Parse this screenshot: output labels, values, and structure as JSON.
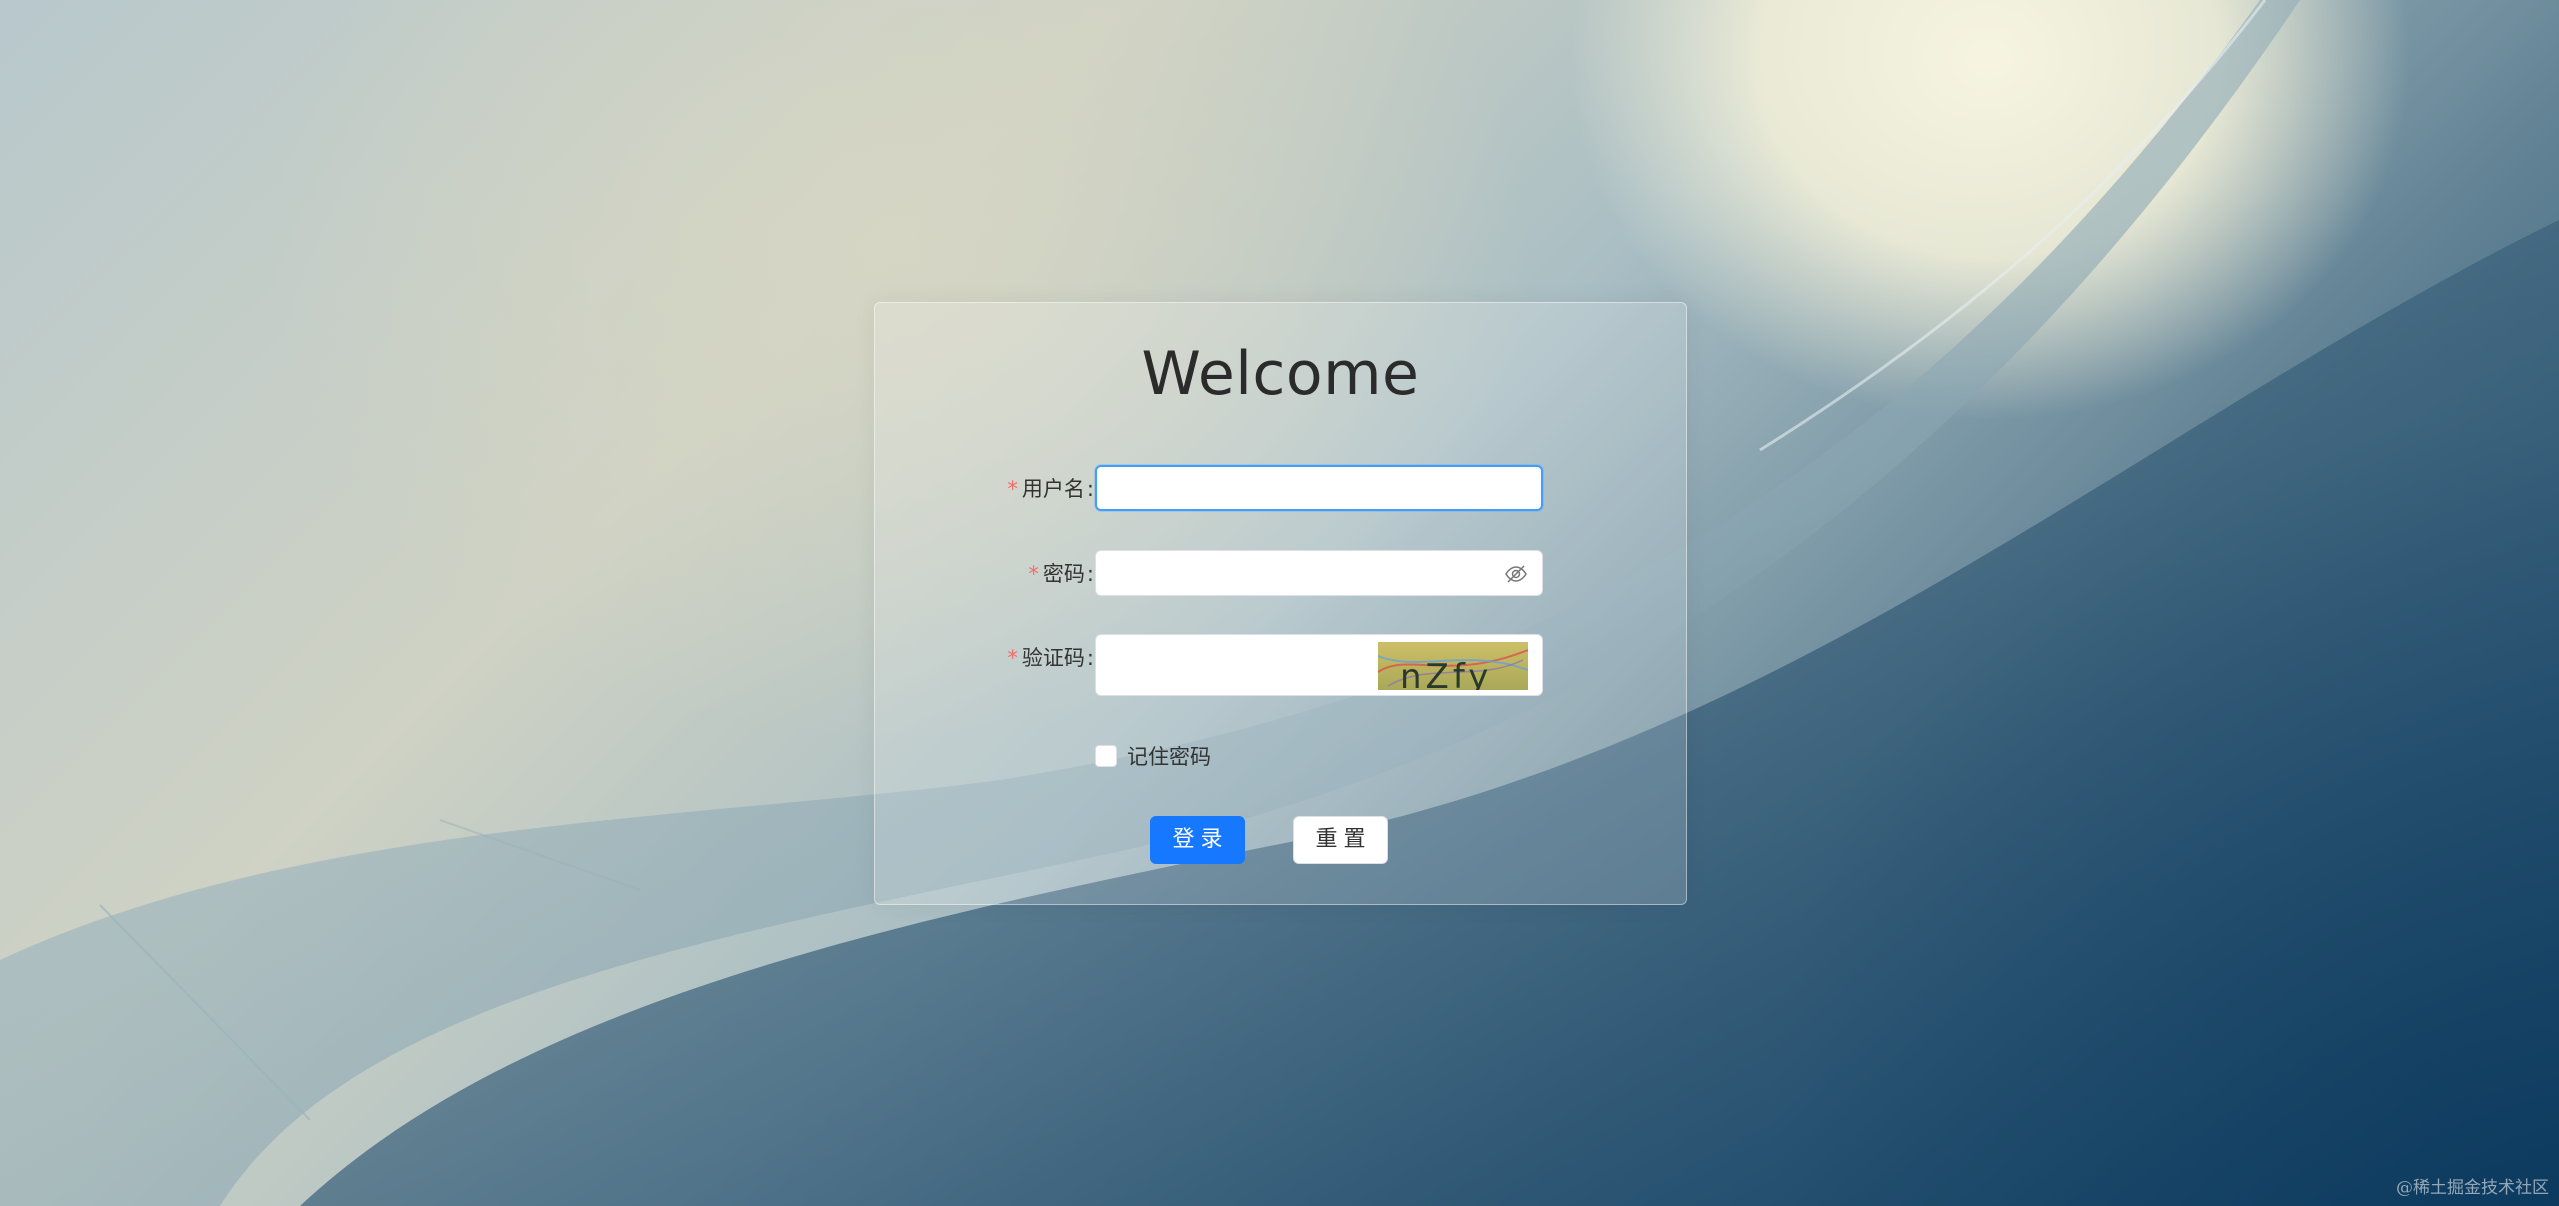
{
  "title": "Welcome",
  "form": {
    "required_mark": "*",
    "username": {
      "label": "用户名",
      "value": "",
      "placeholder": ""
    },
    "password": {
      "label": "密码",
      "value": "",
      "placeholder": ""
    },
    "captcha": {
      "label": "验证码",
      "value": "",
      "placeholder": "",
      "image_text": "nZfy"
    },
    "remember_label": "记住密码",
    "colon": ":"
  },
  "buttons": {
    "login": "登录",
    "reset": "重置"
  },
  "watermark": "@稀土掘金技术社区",
  "colors": {
    "primary": "#1677ff",
    "required": "#f56c6c",
    "focus_border": "#409eff"
  },
  "icons": {
    "password_toggle": "eye-off-icon"
  }
}
